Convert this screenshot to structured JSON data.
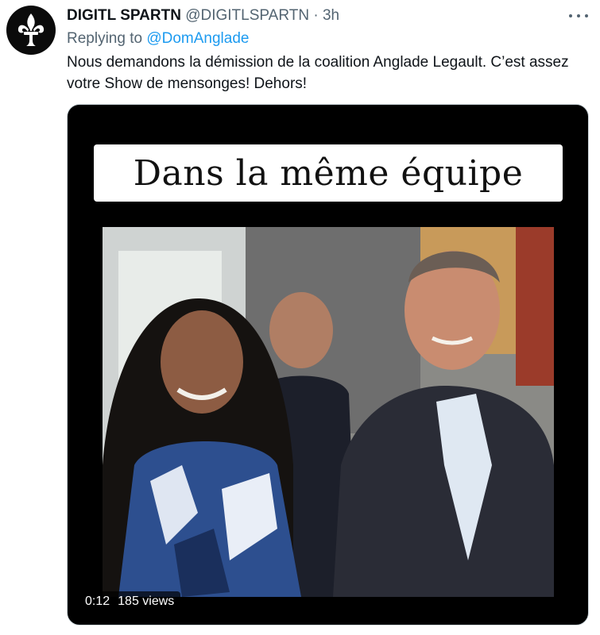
{
  "tweet": {
    "display_name": "DIGITL SPARTN",
    "handle": "@DIGITLSPARTN",
    "separator": "·",
    "time": "3h",
    "reply_prefix": "Replying to",
    "reply_to": "@DomAnglade",
    "text": "Nous demandons la démission de la coalition Anglade Legault. C’est assez votre Show de mensonges! Dehors!",
    "avatar_icon": "fleur-de-lis-icon",
    "more_icon": "more-options-icon"
  },
  "media": {
    "caption": "Dans la même équipe",
    "duration": "0:12",
    "views": "185 views"
  },
  "colors": {
    "link": "#1d9bf0",
    "secondary_text": "#536471",
    "media_background": "#000000"
  }
}
